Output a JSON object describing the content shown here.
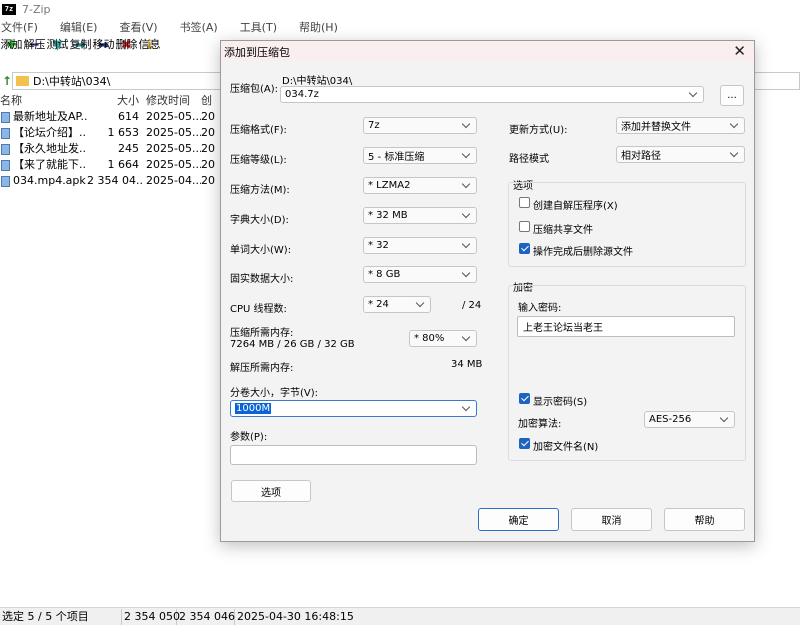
{
  "app": {
    "title": "7-Zip"
  },
  "menu": [
    "文件(F)",
    "编辑(E)",
    "查看(V)",
    "书签(A)",
    "工具(T)",
    "帮助(H)"
  ],
  "toolbar": [
    {
      "label": "添加",
      "icon": "add-icon",
      "glyph": "✚",
      "color": "#21a321"
    },
    {
      "label": "解压",
      "icon": "extract-icon",
      "glyph": "━",
      "color": "#2b2ba8"
    },
    {
      "label": "测试",
      "icon": "test-icon",
      "glyph": "▼",
      "color": "#2aa8a8"
    },
    {
      "label": "复制",
      "icon": "copy-icon",
      "glyph": "➡",
      "color": "#1e8c8c"
    },
    {
      "label": "移动",
      "icon": "move-icon",
      "glyph": "➡",
      "color": "#1e2e7e"
    },
    {
      "label": "删除",
      "icon": "delete-icon",
      "glyph": "✖",
      "color": "#d42020"
    },
    {
      "label": "信息",
      "icon": "info-icon",
      "glyph": "ℹ",
      "color": "#b8920a"
    }
  ],
  "address": {
    "path": "D:\\中转站\\034\\"
  },
  "filelist": {
    "columns": {
      "name": "名称",
      "size": "大小",
      "modified": "修改时间",
      "created": "创"
    },
    "rows": [
      {
        "name": "最新地址及AP...",
        "size": "614",
        "modified": "2025-05...",
        "created": "20"
      },
      {
        "name": "【论坛介绍】....",
        "size": "1 653",
        "modified": "2025-05...",
        "created": "20"
      },
      {
        "name": "【永久地址发...",
        "size": "245",
        "modified": "2025-05...",
        "created": "20"
      },
      {
        "name": "【来了就能下...",
        "size": "1 664",
        "modified": "2025-05...",
        "created": "20"
      },
      {
        "name": "034.mp4.apk",
        "size": "2 354 04...",
        "modified": "2025-04...",
        "created": "20"
      }
    ]
  },
  "status": {
    "selected": "选定 5 / 5 个项目",
    "size1": "2 354 050",
    "size2": "2 354 046",
    "datetime": "2025-04-30 16:48:15"
  },
  "dialog": {
    "title": "添加到压缩包",
    "archive_label": "压缩包(A):",
    "archive_dir": "D:\\中转站\\034\\",
    "archive_name": "034.7z",
    "browse": "...",
    "format_label": "压缩格式(F):",
    "format": "7z",
    "level_label": "压缩等级(L):",
    "level": "5 - 标准压缩",
    "method_label": "压缩方法(M):",
    "method": "* LZMA2",
    "dict_label": "字典大小(D):",
    "dict": "* 32 MB",
    "word_label": "单词大小(W):",
    "word": "* 32",
    "solid_label": "固实数据大小:",
    "solid": "* 8 GB",
    "threads_label": "CPU 线程数:",
    "threads": "* 24",
    "threads_max": "/ 24",
    "mem_comp_label": "压缩所需内存:",
    "mem_comp_value": "7264 MB / 26 GB / 32 GB",
    "mem_comp_pct": "* 80%",
    "mem_decomp_label": "解压所需内存:",
    "mem_decomp_value": "34 MB",
    "split_label": "分卷大小，字节(V):",
    "split": "1000M",
    "params_label": "参数(P):",
    "params": "",
    "options_button": "选项",
    "update_label": "更新方式(U):",
    "update": "添加并替换文件",
    "path_label": "路径模式",
    "path_mode": "相对路径",
    "options_group": "选项",
    "opt_sfx": "创建自解压程序(X)",
    "opt_sfx_checked": false,
    "opt_shared": "压缩共享文件",
    "opt_shared_checked": false,
    "opt_delete": "操作完成后删除源文件",
    "opt_delete_checked": true,
    "encrypt_group": "加密",
    "password_label": "输入密码:",
    "password": "上老王论坛当老王",
    "show_password": "显示密码(S)",
    "show_password_checked": true,
    "enc_method_label": "加密算法:",
    "enc_method": "AES-256",
    "encrypt_names": "加密文件名(N)",
    "encrypt_names_checked": true,
    "ok": "确定",
    "cancel": "取消",
    "help": "帮助"
  }
}
